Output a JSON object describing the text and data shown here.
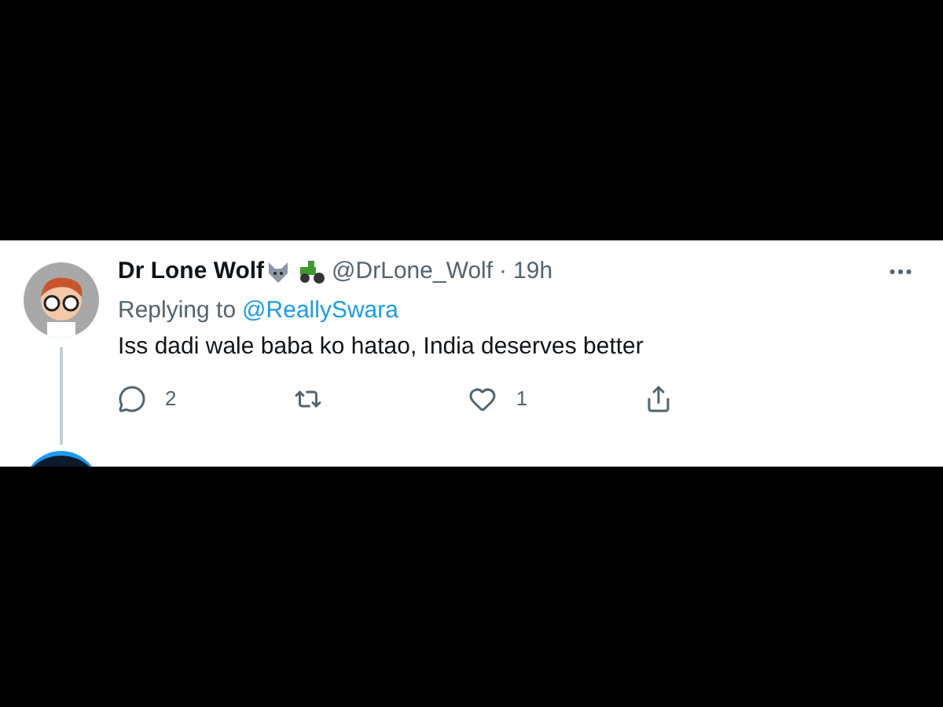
{
  "tweet": {
    "name": "Dr Lone Wolf",
    "handle": "@DrLone_Wolf",
    "separator": "·",
    "time": "19h",
    "replying_prefix": "Replying to",
    "reply_to": "@ReallySwara",
    "text": "Iss dadi wale baba ko hatao, India deserves better",
    "actions": [
      {
        "kind": "reply",
        "count": "2"
      },
      {
        "kind": "retweet"
      },
      {
        "kind": "like",
        "count": "1"
      },
      {
        "kind": "share"
      }
    ]
  }
}
